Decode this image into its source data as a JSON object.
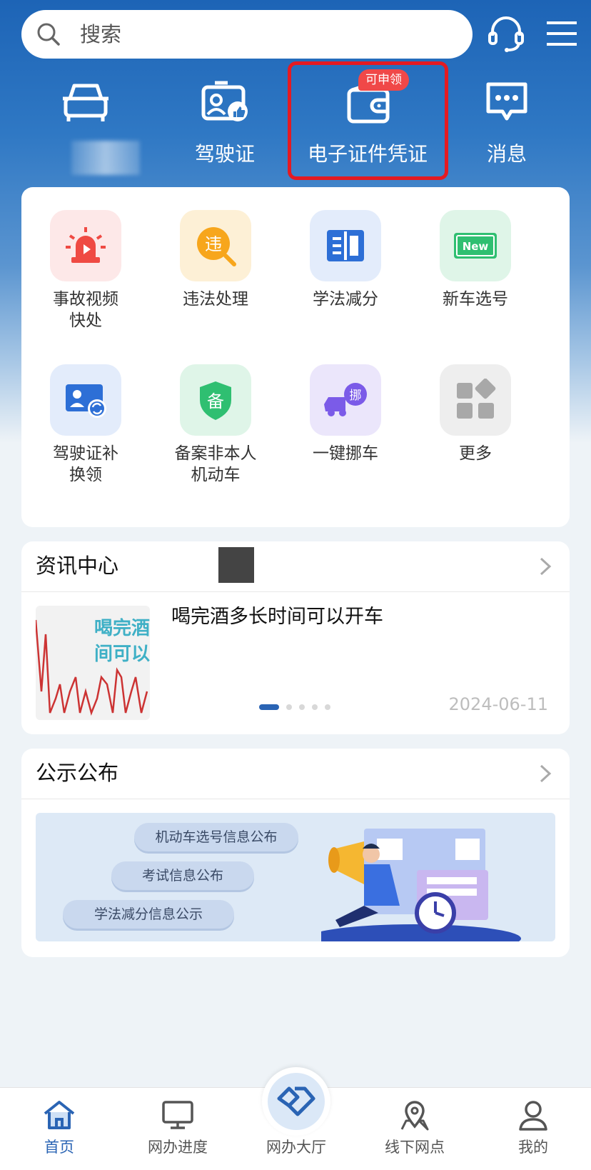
{
  "search": {
    "placeholder": "搜索"
  },
  "header": {
    "support_icon": "headset-icon",
    "menu_icon": "menu-icon"
  },
  "quick_actions": [
    {
      "label": "",
      "icon": "car-icon"
    },
    {
      "label": "驾驶证",
      "icon": "license-icon"
    },
    {
      "label": "电子证件凭证",
      "icon": "wallet-icon",
      "badge": "可申领"
    },
    {
      "label": "消息",
      "icon": "message-icon"
    }
  ],
  "services": [
    {
      "label": "事故视频快处",
      "icon": "alarm-light-icon"
    },
    {
      "label": "违法处理",
      "icon": "violation-icon",
      "glyph": "违"
    },
    {
      "label": "学法减分",
      "icon": "book-icon"
    },
    {
      "label": "新车选号",
      "icon": "new-plate-icon",
      "glyph": "New"
    },
    {
      "label": "驾驶证补换领",
      "icon": "license-replace-icon"
    },
    {
      "label": "备案非本人机动车",
      "icon": "shield-record-icon",
      "glyph": "备"
    },
    {
      "label": "一键挪车",
      "icon": "truck-move-icon",
      "glyph": "挪"
    },
    {
      "label": "更多",
      "icon": "more-grid-icon"
    }
  ],
  "news": {
    "title": "资讯中心",
    "item_title": "喝完酒多长时间可以开车",
    "item_date": "2024-06-11",
    "thumb_text": [
      "喝完酒",
      "间可以"
    ]
  },
  "notices": {
    "title": "公示公布",
    "pills": [
      "机动车选号信息公布",
      "考试信息公布",
      "学法减分信息公示"
    ]
  },
  "tabbar": [
    {
      "label": "首页",
      "icon": "home-icon",
      "active": true
    },
    {
      "label": "网办进度",
      "icon": "monitor-icon"
    },
    {
      "label": "网办大厅",
      "icon": "handshake-icon"
    },
    {
      "label": "线下网点",
      "icon": "map-pin-icon"
    },
    {
      "label": "我的",
      "icon": "user-icon"
    }
  ],
  "colors": {
    "brand": "#2a64b4",
    "highlight_border": "#e41a22",
    "badge": "#f04848"
  }
}
